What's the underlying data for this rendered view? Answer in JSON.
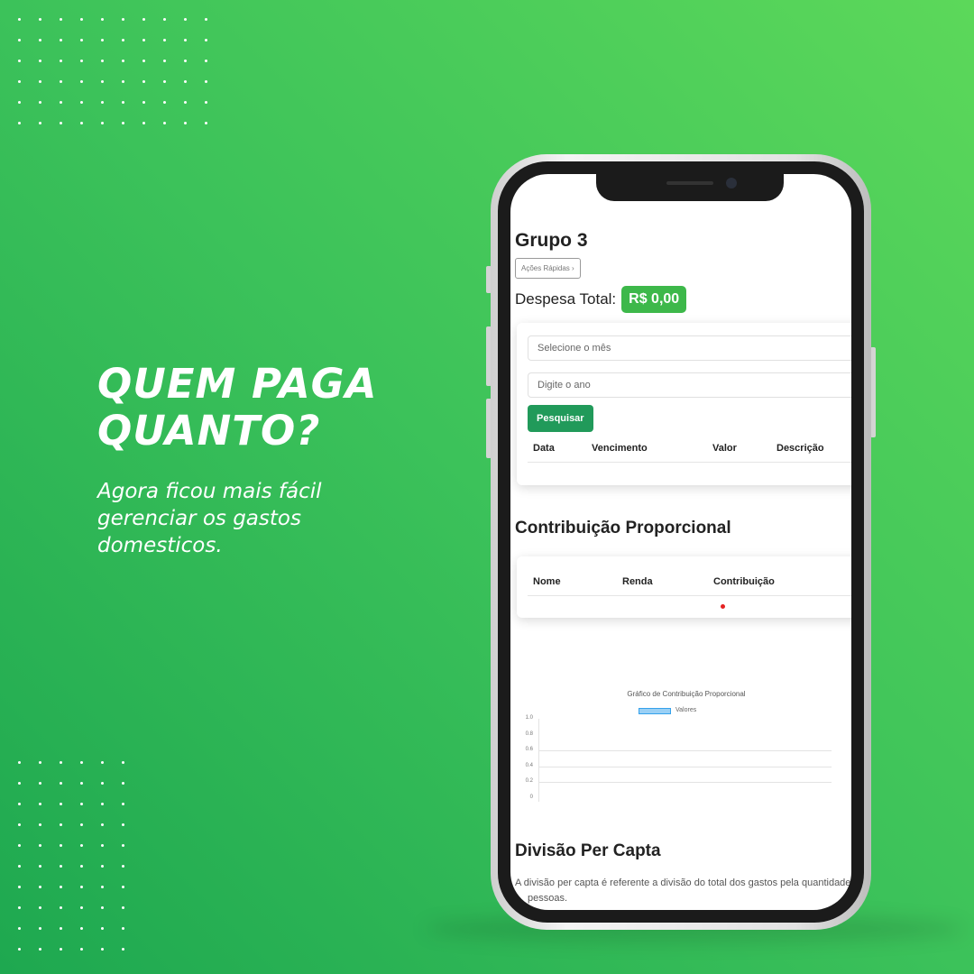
{
  "promo": {
    "headline_line1": "QUEM PAGA",
    "headline_line2": "QUANTO?",
    "subtitle_line1": "Agora ficou mais fácil",
    "subtitle_line2": "gerenciar os gastos",
    "subtitle_line3": "domesticos."
  },
  "app": {
    "title": "Grupo 3",
    "quick_actions": "Ações Rápidas ›",
    "total_label": "Despesa Total:",
    "total_value": "R$ 0,00",
    "filter": {
      "month_placeholder": "Selecione o mês",
      "year_placeholder": "Digite o ano",
      "search_label": "Pesquisar"
    },
    "expenses_table": {
      "columns": [
        "Data",
        "Vencimento",
        "Valor",
        "Descrição"
      ]
    },
    "contribution": {
      "title": "Contribuição Proporcional",
      "columns": [
        "Nome",
        "Renda",
        "Contribuição"
      ]
    },
    "per_capita": {
      "title": "Divisão Per Capta",
      "description_line1": "A divisão per capta é referente a divisão do total dos gastos pela quantidade de",
      "description_line2": "pessoas."
    }
  },
  "chart_data": {
    "type": "bar",
    "title": "Gráfico de Contribuição Proporcional",
    "legend": [
      "Valores"
    ],
    "legend_position": "top",
    "categories": [],
    "series": [
      {
        "name": "Valores",
        "values": [],
        "color": "#9ad0f5"
      }
    ],
    "yticks": [
      "1.0",
      "0.8",
      "0.6",
      "0.4",
      "0.2",
      "0"
    ],
    "ylim": [
      0,
      1
    ]
  }
}
